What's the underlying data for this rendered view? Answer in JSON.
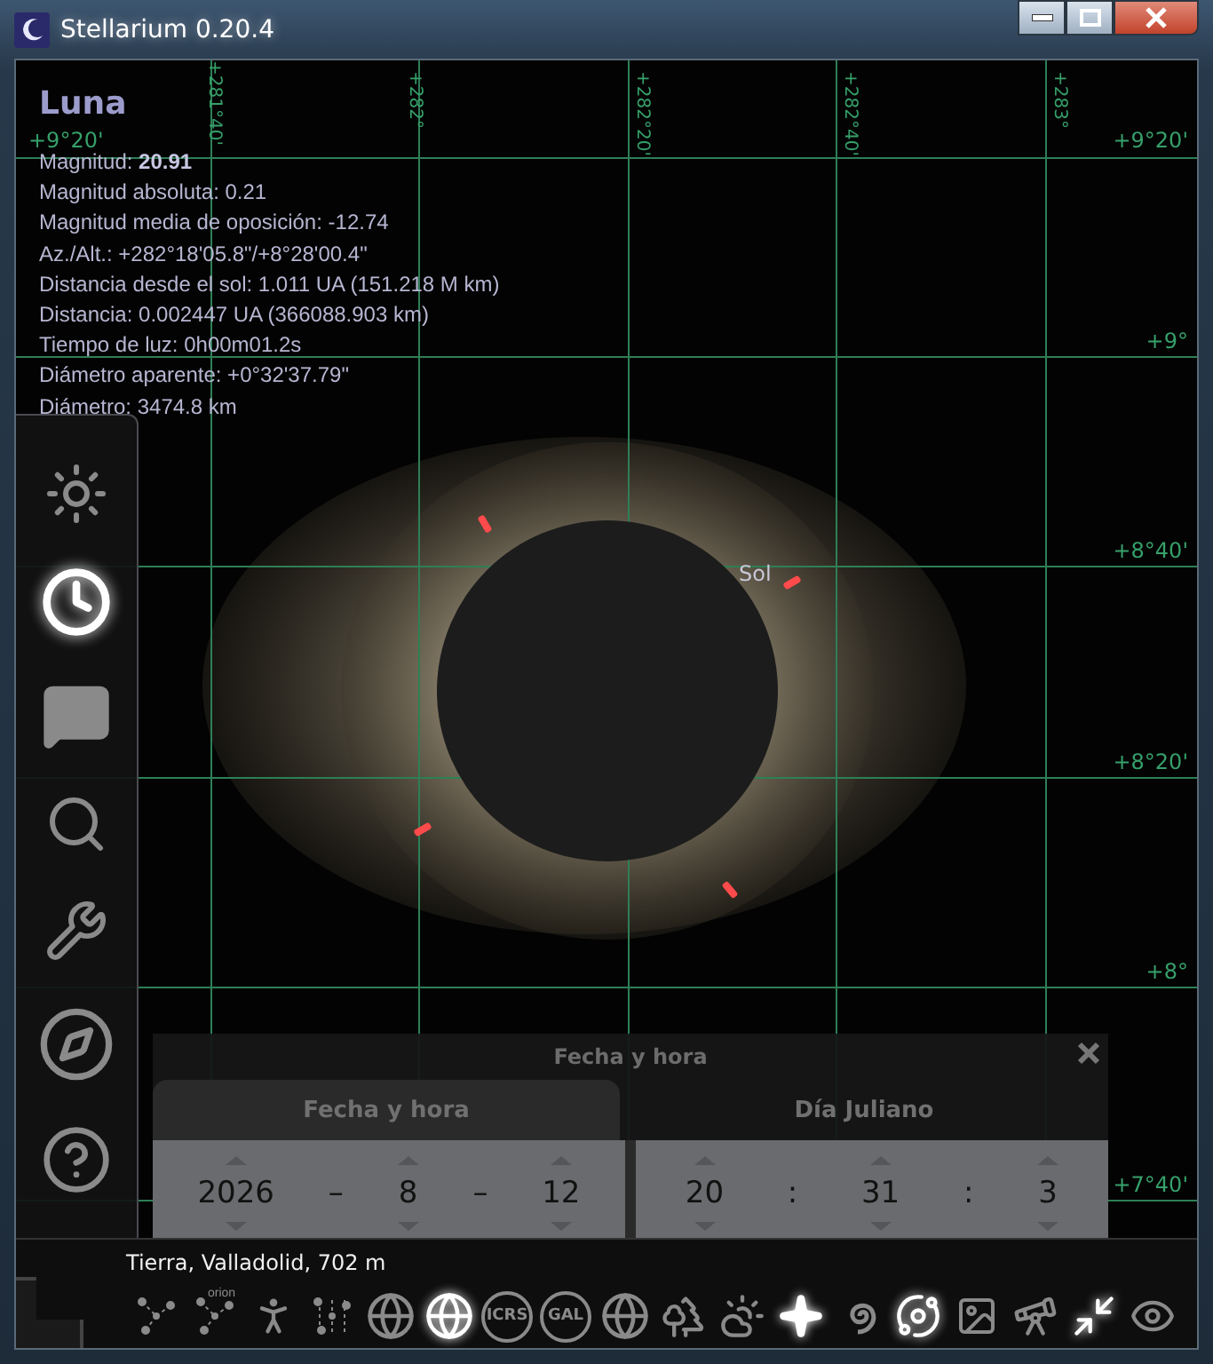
{
  "window": {
    "title": "Stellarium 0.20.4"
  },
  "grid_labels": [
    {
      "kind": "meridian",
      "text": "+281°40'"
    },
    {
      "kind": "meridian",
      "text": "+282°"
    },
    {
      "kind": "meridian",
      "text": "+282°20'"
    },
    {
      "kind": "meridian",
      "text": "+282°40'"
    },
    {
      "kind": "meridian",
      "text": "+283°"
    },
    {
      "kind": "parallel",
      "text": "+9°20'"
    },
    {
      "kind": "parallel",
      "text": "+9°20'"
    },
    {
      "kind": "parallel",
      "text": "+9°"
    },
    {
      "kind": "parallel",
      "text": "+8°40'"
    },
    {
      "kind": "parallel",
      "text": "+8°20'"
    },
    {
      "kind": "parallel",
      "text": "+8°"
    },
    {
      "kind": "parallel",
      "text": "+7°40'"
    }
  ],
  "object_info": {
    "name": "Luna",
    "lines": [
      "Magnitud: **20.91**",
      "Magnitud absoluta: 0.21",
      "Magnitud media de oposición: -12.74",
      "Az./Alt.: +282°18'05.8\"/+8°28'00.4\"",
      "Distancia desde el sol: 1.011 UA (151.218 M km)",
      "Distancia: 0.002447 UA (366088.903 km)",
      "Tiempo de luz: 0h00m01.2s",
      "Diámetro aparente: +0°32'37.79\"",
      "Diámetro: 3474.8 km"
    ]
  },
  "sky_label": "Sol",
  "sidebar": {
    "items": [
      {
        "kind": "sky",
        "selected": false
      },
      {
        "kind": "clock",
        "selected": true
      },
      {
        "kind": "objects",
        "selected": false
      },
      {
        "kind": "search",
        "selected": false
      },
      {
        "kind": "settings",
        "selected": false
      },
      {
        "kind": "compass",
        "selected": false
      },
      {
        "kind": "help",
        "selected": false
      }
    ]
  },
  "date_dialog": {
    "title": "Fecha y hora",
    "tabs": [
      {
        "label": "Fecha y hora",
        "selected": true
      },
      {
        "label": "Día Juliano",
        "selected": false
      }
    ],
    "groups": [
      {
        "items": [
          {
            "kind": "number",
            "value": "2026"
          },
          {
            "kind": "separator",
            "value": "–"
          },
          {
            "kind": "number",
            "value": "8"
          },
          {
            "kind": "separator",
            "value": "–"
          },
          {
            "kind": "number",
            "value": "12"
          }
        ]
      },
      {
        "items": [
          {
            "kind": "number",
            "value": "20"
          },
          {
            "kind": "separator",
            "value": ":"
          },
          {
            "kind": "number",
            "value": "31"
          },
          {
            "kind": "separator",
            "value": ":"
          },
          {
            "kind": "number",
            "value": "3"
          }
        ]
      }
    ]
  },
  "location": "Tierra, Valladolid, 702 m",
  "toolbar": {
    "items": [
      {
        "kind": "lines",
        "on": false
      },
      {
        "kind": "labels",
        "on": false,
        "caption": "orion"
      },
      {
        "kind": "figure",
        "on": false
      },
      {
        "kind": "boundaries",
        "on": false
      },
      {
        "kind": "globe",
        "on": false
      },
      {
        "kind": "grid",
        "on": true
      },
      {
        "kind": "text",
        "on": false,
        "caption": "ICRS"
      },
      {
        "kind": "text",
        "on": false,
        "caption": "GAL"
      },
      {
        "kind": "globe",
        "on": false
      },
      {
        "kind": "ground",
        "on": false
      },
      {
        "kind": "atmosphere",
        "on": false
      },
      {
        "kind": "stars",
        "on": true
      },
      {
        "kind": "galaxy",
        "on": false
      },
      {
        "kind": "planet",
        "on": true
      },
      {
        "kind": "images",
        "on": false
      },
      {
        "kind": "telescope",
        "on": false
      },
      {
        "kind": "fullscreen",
        "on": true
      },
      {
        "kind": "eye",
        "on": false
      }
    ]
  }
}
